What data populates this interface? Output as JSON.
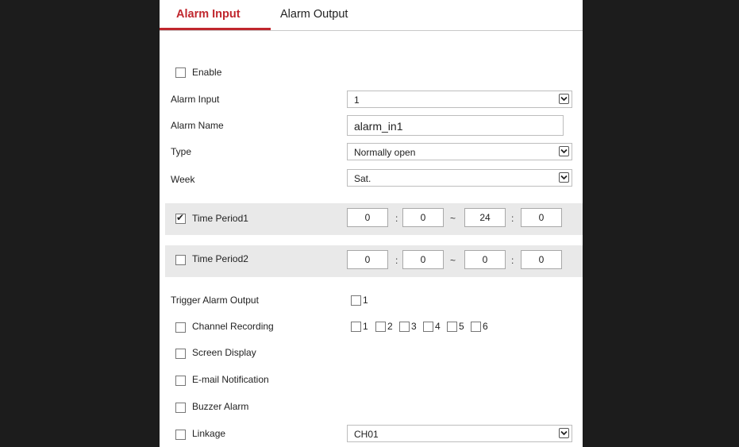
{
  "tabs": {
    "alarm_input": "Alarm Input",
    "alarm_output": "Alarm Output"
  },
  "form": {
    "enable_label": "Enable",
    "alarm_input_label": "Alarm Input",
    "alarm_input_value": "1",
    "alarm_name_label": "Alarm Name",
    "alarm_name_value": "alarm_in1",
    "type_label": "Type",
    "type_value": "Normally open",
    "week_label": "Week",
    "week_value": "Sat."
  },
  "periods": {
    "p1": {
      "label": "Time Period1",
      "checked": true,
      "start_h": "0",
      "start_m": "0",
      "end_h": "24",
      "end_m": "0"
    },
    "p2": {
      "label": "Time Period2",
      "checked": false,
      "start_h": "0",
      "start_m": "0",
      "end_h": "0",
      "end_m": "0"
    },
    "colon": ":",
    "tilde": "~"
  },
  "actions": {
    "trigger_output_label": "Trigger Alarm Output",
    "trigger_output_options": [
      "1"
    ],
    "channel_recording_label": "Channel Recording",
    "channel_options": [
      "1",
      "2",
      "3",
      "4",
      "5",
      "6"
    ],
    "screen_display_label": "Screen Display",
    "email_label": "E-mail Notification",
    "buzzer_label": "Buzzer Alarm",
    "linkage_label": "Linkage",
    "linkage_value": "CH01"
  },
  "colors": {
    "accent": "#c0262d",
    "background": "#1c1c1c",
    "band": "#e9e9e9"
  },
  "icons": {
    "dropdown": "chevron-down-icon",
    "check": "checkmark-icon"
  }
}
